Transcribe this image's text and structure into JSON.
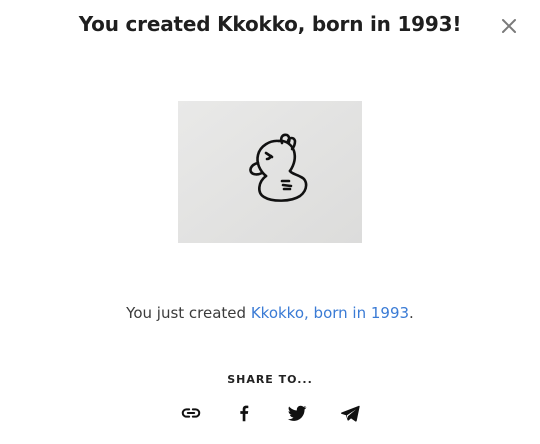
{
  "modal": {
    "title": "You created Kkokko, born in 1993!",
    "close_icon": "close-icon"
  },
  "image": {
    "icon": "duck-drawing"
  },
  "message": {
    "prefix": "You just created ",
    "link_text": "Kkokko, born in 1993",
    "suffix": "."
  },
  "share": {
    "label": "SHARE TO...",
    "icons": [
      "link-icon",
      "facebook-icon",
      "twitter-icon",
      "telegram-icon"
    ]
  },
  "colors": {
    "link": "#3a7bd5",
    "title": "#1f1f1f",
    "image_bg": "#e7e7e6"
  }
}
